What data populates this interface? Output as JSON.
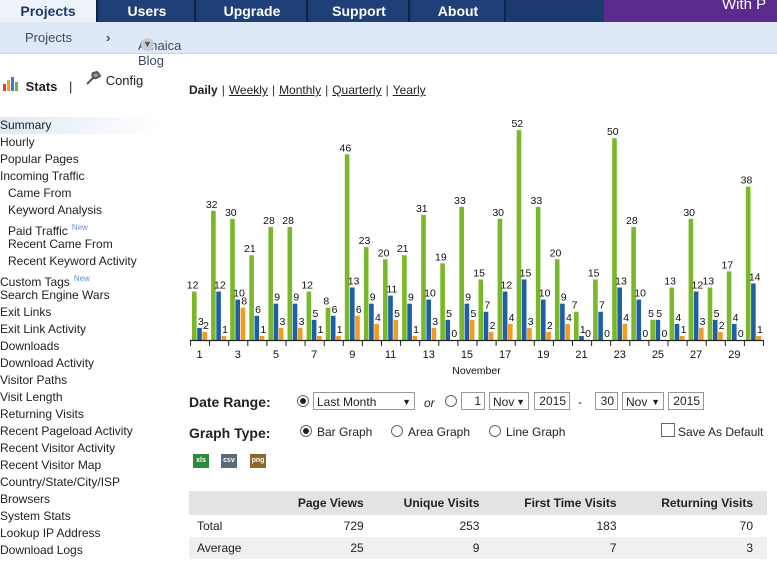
{
  "tabs": [
    {
      "label": "Projects",
      "active": true
    },
    {
      "label": "Users",
      "active": false
    },
    {
      "label": "Upgrade",
      "active": false
    },
    {
      "label": "Support",
      "active": false
    },
    {
      "label": "About",
      "active": false
    }
  ],
  "brand_partial": "With P",
  "subnav": {
    "crumb1": "Projects",
    "sep": "›",
    "crumb2": "Amaica Blog"
  },
  "side_top": {
    "stats": "Stats",
    "divider": "|",
    "config": "Config"
  },
  "menu": [
    {
      "label": "Summary",
      "sub": false
    },
    {
      "label": "Hourly",
      "sub": false
    },
    {
      "label": "Popular Pages",
      "sub": false
    },
    {
      "label": "Incoming Traffic",
      "sub": false
    },
    {
      "label": "Came From",
      "sub": true
    },
    {
      "label": "Keyword Analysis",
      "sub": true
    },
    {
      "label": "Paid Traffic",
      "sub": true,
      "badge": "New"
    },
    {
      "label": "Recent Came From",
      "sub": true
    },
    {
      "label": "Recent Keyword Activity",
      "sub": true
    },
    {
      "label": "Custom Tags",
      "sub": false,
      "badge": "New"
    },
    {
      "label": "Search Engine Wars",
      "sub": false
    },
    {
      "label": "Exit Links",
      "sub": false
    },
    {
      "label": "Exit Link Activity",
      "sub": false
    },
    {
      "label": "Downloads",
      "sub": false
    },
    {
      "label": "Download Activity",
      "sub": false
    },
    {
      "label": "Visitor Paths",
      "sub": false
    },
    {
      "label": "Visit Length",
      "sub": false
    },
    {
      "label": "Returning Visits",
      "sub": false
    },
    {
      "label": "Recent Pageload Activity",
      "sub": false
    },
    {
      "label": "Recent Visitor Activity",
      "sub": false
    },
    {
      "label": "Recent Visitor Map",
      "sub": false
    },
    {
      "label": "Country/State/City/ISP",
      "sub": false
    },
    {
      "label": "Browsers",
      "sub": false
    },
    {
      "label": "System Stats",
      "sub": false
    },
    {
      "label": "Lookup IP Address",
      "sub": false
    },
    {
      "label": "Download Logs",
      "sub": false
    }
  ],
  "periods": {
    "daily": "Daily",
    "weekly": "Weekly",
    "monthly": "Monthly",
    "quarterly": "Quarterly",
    "yearly": "Yearly",
    "sep": "|"
  },
  "chart_data": {
    "type": "bar",
    "xlabel": "November",
    "categories": [
      1,
      2,
      3,
      4,
      5,
      6,
      7,
      8,
      9,
      10,
      11,
      12,
      13,
      14,
      15,
      16,
      17,
      18,
      19,
      20,
      21,
      22,
      23,
      24,
      25,
      26,
      27,
      28,
      29,
      30
    ],
    "tick_labels": [
      "1",
      "3",
      "5",
      "7",
      "9",
      "11",
      "13",
      "15",
      "17",
      "19",
      "21",
      "23",
      "25",
      "27",
      "29"
    ],
    "colors": [
      "#7ab82a",
      "#1f5fa8",
      "#f29b1e"
    ],
    "series": [
      {
        "values": [
          12,
          32,
          30,
          21,
          28,
          28,
          12,
          8,
          46,
          23,
          20,
          21,
          31,
          19,
          33,
          15,
          30,
          52,
          33,
          20,
          7,
          15,
          50,
          28,
          5,
          13,
          30,
          13,
          17,
          38
        ]
      },
      {
        "values": [
          3,
          12,
          10,
          6,
          9,
          9,
          5,
          6,
          13,
          9,
          11,
          9,
          10,
          5,
          9,
          7,
          12,
          15,
          10,
          9,
          1,
          7,
          13,
          10,
          5,
          4,
          12,
          5,
          4,
          14
        ]
      },
      {
        "values": [
          2,
          1,
          8,
          1,
          3,
          3,
          1,
          1,
          6,
          4,
          5,
          1,
          3,
          0,
          5,
          2,
          4,
          3,
          2,
          4,
          0,
          0,
          4,
          0,
          0,
          1,
          3,
          2,
          0,
          1
        ]
      }
    ]
  },
  "form": {
    "date_range_label": "Date Range:",
    "range_value": "Last Month",
    "or": "or",
    "from_day": "1",
    "from_month": "Nov",
    "from_year": "2015",
    "dash": "-",
    "to_day": "30",
    "to_month": "Nov",
    "to_year": "2015",
    "graph_type_label": "Graph Type:",
    "opt_bar": "Bar Graph",
    "opt_area": "Area Graph",
    "opt_line": "Line Graph",
    "save_default": "Save As Default",
    "export_icons": [
      "xls",
      "csv",
      "png"
    ]
  },
  "table": {
    "headers": [
      "",
      "Page Views",
      "Unique Visits",
      "First Time Visits",
      "Returning Visits"
    ],
    "rows": [
      [
        "Total",
        "729",
        "253",
        "183",
        "70"
      ],
      [
        "Average",
        "25",
        "9",
        "7",
        "3"
      ]
    ]
  }
}
